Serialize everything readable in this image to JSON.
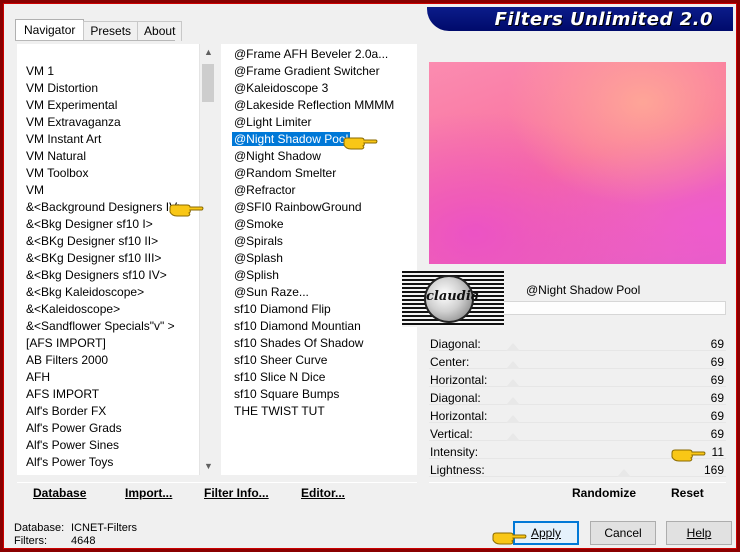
{
  "window": {
    "title": "Filters Unlimited 2.0"
  },
  "tabs": [
    {
      "label": "Navigator"
    },
    {
      "label": "Presets"
    },
    {
      "label": "About"
    }
  ],
  "categories": [
    "VM 1",
    "VM Distortion",
    "VM Experimental",
    "VM Extravaganza",
    "VM Instant Art",
    "VM Natural",
    "VM Toolbox",
    "VM",
    "&<Background Designers IV>",
    "&<Bkg Designer sf10 I>",
    "&<BKg Designer sf10 II>",
    "&<BKg Designer sf10 III>",
    "&<Bkg Designers sf10 IV>",
    "&<Bkg Kaleidoscope>",
    "&<Kaleidoscope>",
    "&<Sandflower Specials\"v\" >",
    "[AFS IMPORT]",
    "AB Filters 2000",
    "AFH",
    "AFS IMPORT",
    "Alf's Border FX",
    "Alf's Power Grads",
    "Alf's Power Sines",
    "Alf's Power Toys"
  ],
  "filters": [
    "@Frame AFH Beveler 2.0a...",
    "@Frame Gradient Switcher",
    "@Kaleidoscope 3",
    "@Lakeside Reflection MMMM",
    "@Light Limiter",
    "@Night Shadow Pool",
    "@Night Shadow",
    "@Random Smelter",
    "@Refractor",
    "@SFI0 RainbowGround",
    "@Smoke",
    "@Spirals",
    "@Splash",
    "@Splish",
    "@Sun Raze...",
    "sf10 Diamond Flip",
    "sf10 Diamond Mountian",
    "sf10 Shades Of Shadow",
    "sf10 Sheer Curve",
    "sf10 Slice N Dice",
    "sf10 Square Bumps",
    "THE TWIST TUT"
  ],
  "selected_filter_index": 5,
  "preview": {
    "filter_name": "@Night Shadow Pool",
    "logo_text": "claudia"
  },
  "sliders": [
    {
      "label": "Diagonal:",
      "value": "69",
      "level": 69
    },
    {
      "label": "Center:",
      "value": "69",
      "level": 69
    },
    {
      "label": "Horizontal:",
      "value": "69",
      "level": 69
    },
    {
      "label": "Diagonal:",
      "value": "69",
      "level": 69
    },
    {
      "label": "Horizontal:",
      "value": "69",
      "level": 69
    },
    {
      "label": "Vertical:",
      "value": "69",
      "level": 69
    },
    {
      "label": "Intensity:",
      "value": "11",
      "level": 11
    },
    {
      "label": "Lightness:",
      "value": "169",
      "level": 169
    }
  ],
  "toolbar": {
    "database": "Database",
    "import": "Import...",
    "filter_info": "Filter Info...",
    "editor": "Editor...",
    "randomize": "Randomize",
    "reset": "Reset"
  },
  "status": {
    "database_label": "Database:",
    "database_value": "ICNET-Filters",
    "filters_label": "Filters:",
    "filters_value": "4648"
  },
  "buttons": {
    "apply": "Apply",
    "cancel": "Cancel",
    "help": "Help"
  },
  "colors": {
    "selection": "#0078d7",
    "frame": "#8a0000",
    "banner": "#000a6b"
  }
}
